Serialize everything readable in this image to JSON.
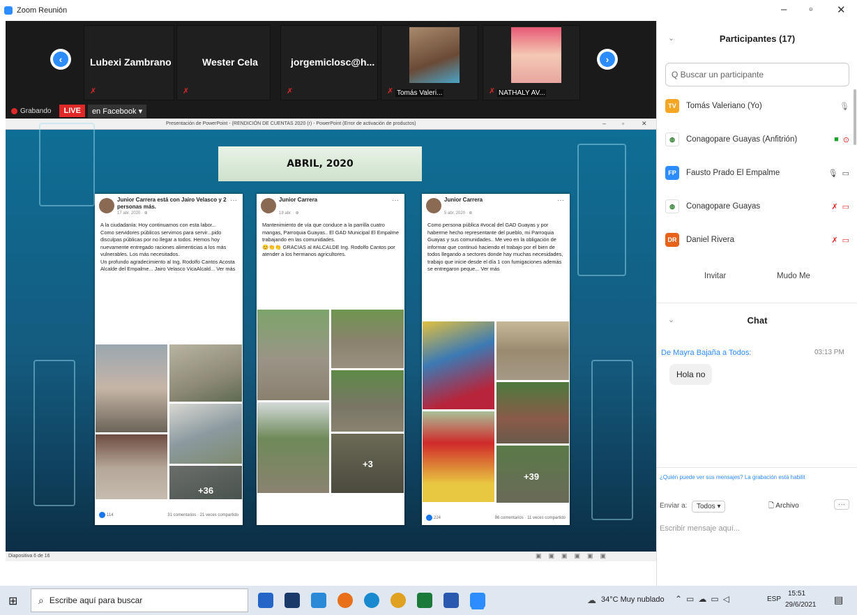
{
  "window": {
    "title": "Zoom Reunión"
  },
  "strip": {
    "tiles": [
      {
        "name": "Lubexi Zambrano"
      },
      {
        "name": "Wester Cela"
      },
      {
        "name": "jorgemiclosc@h..."
      },
      {
        "caption": "Tomás Valeri..."
      },
      {
        "caption": "NATHALY AV..."
      }
    ]
  },
  "recording": {
    "label": "Grabando",
    "live": "LIVE",
    "platform": "en Facebook ▾"
  },
  "ppt": {
    "titlebar": "Presentación de PowerPoint - (RENDICIÓN DE CUENTAS 2020 (r) - PowerPoint (Error de activación de productos)",
    "status": "Diapositiva 6 de 16",
    "slide_title": "ABRIL, 2020",
    "posts": [
      {
        "author": "Junior Carrera está con Jairo Velasco y 2 personas más.",
        "date": "17 abr. 2020 · ⊕",
        "body": "A la ciudadanía: Hoy continuamos con esta labor...\nComo servidores públicos servimos para servir...pido disculpas públicas por no llegar a todos. Hemos hoy nuevamente entregado raciones alimenticias a los más vulnerables. Los más necesitados.\nUn profundo agradecimiento al Ing. Rodolfo Cantos Acosta Alcalde del Empalme... Jairo Velasco VicaAlcald... Ver más",
        "more": "+36",
        "reactions": "114",
        "stats": "31 comentarios · 21 veces compartido"
      },
      {
        "author": "Junior Carrera",
        "date": "19 abr. · ⊕",
        "body": "Mantenimiento de vía que conduce a la parrilla cuatro mangas, Parroquia Guayas.. El GAD Municipal El Empalme trabajando en las comunidades.\n😊👏👏 GRACIAS al #ALCALDE Ing. Rodolfo Cantos por atender a los hermanos agricultores.",
        "more": "+3",
        "reactions": "",
        "stats": ""
      },
      {
        "author": "Junior Carrera",
        "date": "5 abr. 2020 · ⊕",
        "body": "Como persona pública #vocal del GAD Guayas y por haberme hecho representante del pueblo, mi Parroquia Guayas y sus comunidades.. Me veo en la obligación de informar que continuó haciendo el trabajo por el bien de todos llegando a sectores donde hay muchas necesidades, trabajo que inicie desde el día 1 con fumigaciones además se entregaron peque... Ver más",
        "more": "+39",
        "reactions": "224",
        "stats": "86 comentarios · 11 veces compartido"
      }
    ]
  },
  "panel": {
    "participants_title": "Participantes (17)",
    "search_placeholder": "Q Buscar un participante",
    "participants": [
      {
        "initials": "TV",
        "name": "Tomás Valeriano (Yo)",
        "color": "#f5a623"
      },
      {
        "initials": "",
        "name": "Conagopare Guayas (Anfitrión)",
        "color": "#ffffff"
      },
      {
        "initials": "FP",
        "name": "Fausto Prado El Empalme",
        "color": "#2d8cff"
      },
      {
        "initials": "",
        "name": "Conagopare Guayas",
        "color": "#ffffff"
      },
      {
        "initials": "DR",
        "name": "Daniel Rivera",
        "color": "#e8631a"
      }
    ],
    "invite": "Invitar",
    "mute_me": "Mudo Me",
    "chat_title": "Chat",
    "chat_from": "De Mayra Bajaña a Todos:",
    "chat_time": "03:13 PM",
    "chat_message": "Hola no",
    "notice": "¿Quién puede ver sus mensajes? La grabación está habilit",
    "send_to": "Enviar a:",
    "send_target": "Todos ▾",
    "file": "Archivo",
    "input_placeholder": "Escribir mensaje aquí..."
  },
  "taskbar": {
    "search": "Escribe aquí para buscar",
    "weather": "34°C  Muy nublado",
    "lang": "ESP",
    "time": "15:51",
    "date": "29/6/2021"
  },
  "colors": {
    "zoom_blue": "#2d8cff",
    "live_red": "#e02828",
    "slide_top": "#0f6e95",
    "slide_bottom": "#0b2e45"
  }
}
